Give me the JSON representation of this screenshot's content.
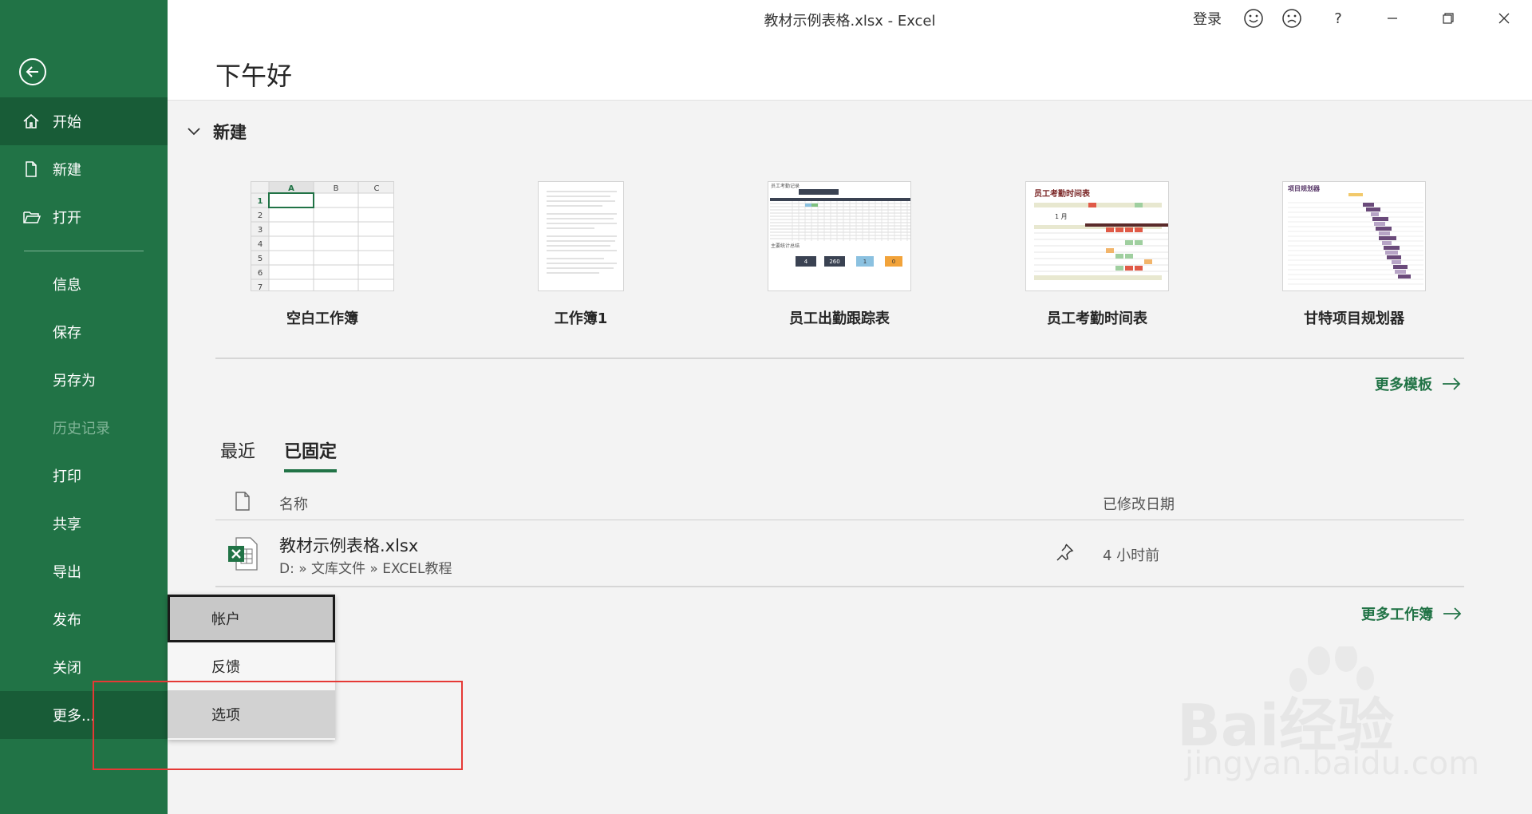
{
  "window": {
    "title": "教材示例表格.xlsx  -  Excel",
    "sign_in": "登录",
    "help": "?"
  },
  "sidebar": {
    "items": [
      {
        "label": "开始",
        "icon": "home-icon"
      },
      {
        "label": "新建",
        "icon": "new-document-icon"
      },
      {
        "label": "打开",
        "icon": "open-folder-icon"
      },
      {
        "label": "信息"
      },
      {
        "label": "保存"
      },
      {
        "label": "另存为"
      },
      {
        "label": "历史记录"
      },
      {
        "label": "打印"
      },
      {
        "label": "共享"
      },
      {
        "label": "导出"
      },
      {
        "label": "发布"
      },
      {
        "label": "关闭"
      },
      {
        "label": "更多..."
      }
    ]
  },
  "greeting": "下午好",
  "new_section": {
    "title": "新建",
    "templates": [
      {
        "name": "空白工作簿"
      },
      {
        "name": "工作簿1"
      },
      {
        "name": "员工出勤跟踪表"
      },
      {
        "name": "员工考勤时间表"
      },
      {
        "name": "甘特项目规划器"
      }
    ],
    "more_templates": "更多模板"
  },
  "thumbs": {
    "blank": {
      "cols": [
        "A",
        "B",
        "C"
      ],
      "rows": [
        "1",
        "2",
        "3",
        "4",
        "5",
        "6",
        "7"
      ]
    },
    "attendance": {
      "heading": "员工考勤记录",
      "summary": "主要统计总结",
      "stats": [
        "4",
        "260",
        "1",
        "0"
      ]
    },
    "timesheet": {
      "title": "员工考勤时间表",
      "month": "1 月"
    },
    "gantt": {
      "title": "项目规划器"
    }
  },
  "files": {
    "tabs": [
      "最近",
      "已固定"
    ],
    "selected_tab": "已固定",
    "col_name": "名称",
    "col_modified": "已修改日期",
    "rows": [
      {
        "name": "教材示例表格.xlsx",
        "path": "D: » 文库文件 » EXCEL教程",
        "modified": "4 小时前"
      }
    ],
    "more_workbooks": "更多工作簿"
  },
  "popup": {
    "items": [
      "帐户",
      "反馈",
      "选项"
    ]
  },
  "watermark": {
    "brand": "Bai经验",
    "url": "jingyan.baidu.com"
  },
  "colors": {
    "accent": "#217346",
    "active": "#185c37",
    "highlight": "#e53935"
  }
}
